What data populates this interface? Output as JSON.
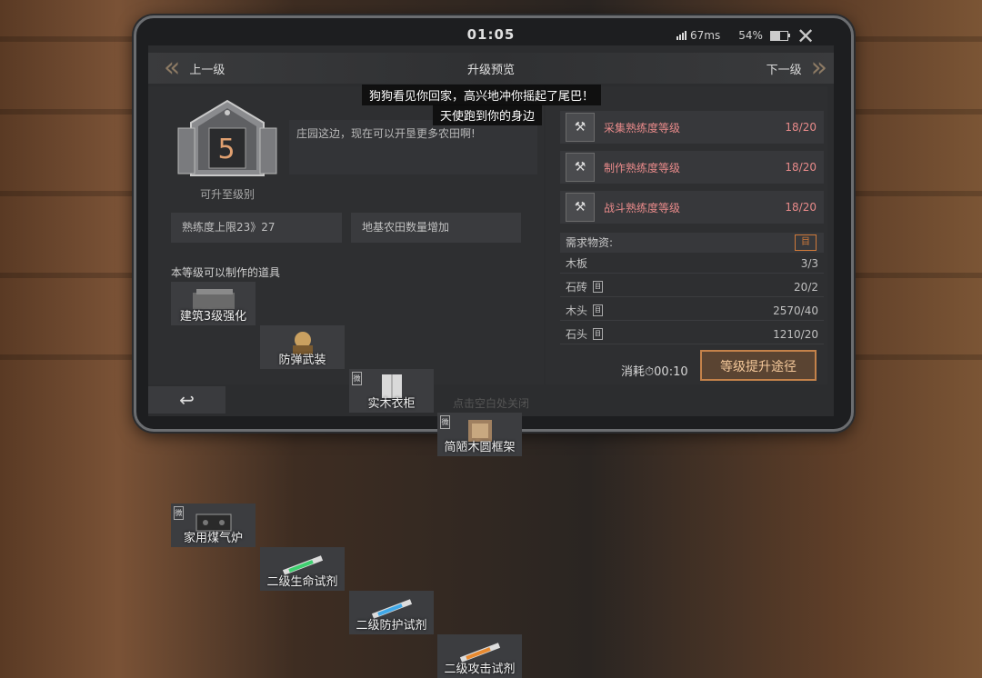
{
  "status_bar": {
    "time": "01:05",
    "ping": "67ms",
    "battery": "54%",
    "battery_level": 0.54
  },
  "nav": {
    "title": "升级预览",
    "prev_label": "上一级",
    "next_label": "下一级"
  },
  "toasts": [
    "狗狗看见你回家，高兴地冲你摇起了尾巴！",
    "天使跑到你的身边"
  ],
  "level": {
    "value": "5",
    "caption": "可升至级别",
    "description": "庄园这边，现在可以开垦更多农田啊!"
  },
  "bonuses": [
    "熟练度上限23》27",
    "地基农田数量增加"
  ],
  "craft": {
    "title": "本等级可以制作的道具",
    "items": [
      {
        "name": "建筑3级强化",
        "tag": ""
      },
      {
        "name": "防弹武装",
        "tag": ""
      },
      {
        "name": "实木衣柜",
        "tag": "微"
      },
      {
        "name": "简陋木圆框架",
        "tag": "微"
      },
      {
        "name": "家用煤气炉",
        "tag": "微"
      },
      {
        "name": "二级生命试剂",
        "tag": ""
      },
      {
        "name": "二级防护试剂",
        "tag": ""
      },
      {
        "name": "二级攻击试剂",
        "tag": ""
      }
    ]
  },
  "proficiency": [
    {
      "name": "采集熟练度等级",
      "value": "18/20"
    },
    {
      "name": "制作熟练度等级",
      "value": "18/20"
    },
    {
      "name": "战斗熟练度等级",
      "value": "18/20"
    }
  ],
  "requirements": {
    "title": "需求物资:",
    "items": [
      {
        "name": "木板",
        "value": "3/3",
        "icon": false
      },
      {
        "name": "石砖",
        "value": "20/2",
        "icon": true
      },
      {
        "name": "木头",
        "value": "2570/40",
        "icon": true
      },
      {
        "name": "石头",
        "value": "1210/20",
        "icon": true
      }
    ]
  },
  "cost": {
    "label": "消耗",
    "time": "00:10"
  },
  "upgrade_button": "等级提升途径",
  "hint": "点击空白处关闭",
  "colors": {
    "accent": "#c4824a",
    "warn_text": "#e88a8a",
    "level_digit": "#e0a070"
  }
}
